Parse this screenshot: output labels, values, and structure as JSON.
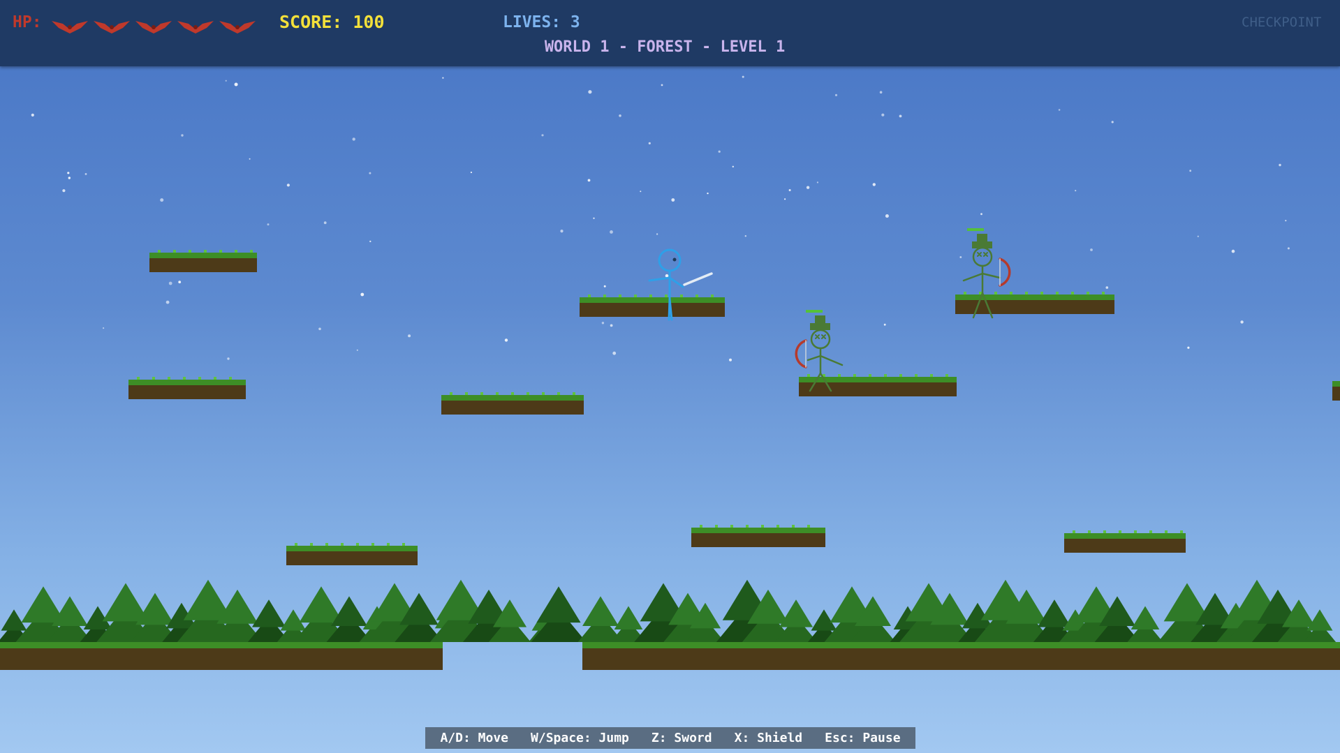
{
  "hud": {
    "hp_label": "HP:",
    "hp_hearts": 5,
    "score_text": "SCORE: 100",
    "lives_text": "LIVES: 3",
    "checkpoint_text": "CHECKPOINT",
    "level_text": "WORLD 1 - FOREST - LEVEL 1"
  },
  "controls": [
    "A/D: Move",
    "W/Space: Jump",
    "Z: Sword",
    "X: Shield",
    "Esc: Pause"
  ],
  "colors": {
    "hud_bg": "#1f3a64",
    "hp": "#c0392b",
    "score": "#f3e03a",
    "lives": "#7db3ee",
    "level": "#c9b4ec",
    "player": "#2ea0e8",
    "enemy": "#4a7a35",
    "grass": "#3d8e26",
    "dirt": "#4d3a18"
  },
  "characters": {
    "player": "stick-figure-swordsman",
    "enemies": [
      "stick-figure-archer",
      "stick-figure-archer"
    ]
  }
}
